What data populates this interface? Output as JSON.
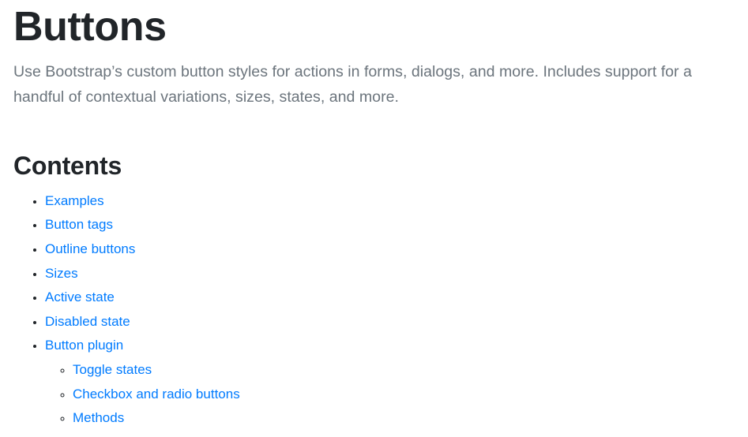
{
  "page": {
    "title": "Buttons",
    "lead": "Use Bootstrap’s custom button styles for actions in forms, dialogs, and more. Includes support for a handful of contextual variations, sizes, states, and more.",
    "link_color": "#007bff",
    "heading_color": "#212529",
    "lead_color": "#6c757d",
    "background_color": "#ffffff"
  },
  "contents": {
    "heading": "Contents",
    "items": [
      {
        "label": "Examples"
      },
      {
        "label": "Button tags"
      },
      {
        "label": "Outline buttons"
      },
      {
        "label": "Sizes"
      },
      {
        "label": "Active state"
      },
      {
        "label": "Disabled state"
      },
      {
        "label": "Button plugin"
      }
    ],
    "sub_items": [
      {
        "label": "Toggle states"
      },
      {
        "label": "Checkbox and radio buttons"
      },
      {
        "label": "Methods"
      }
    ]
  }
}
